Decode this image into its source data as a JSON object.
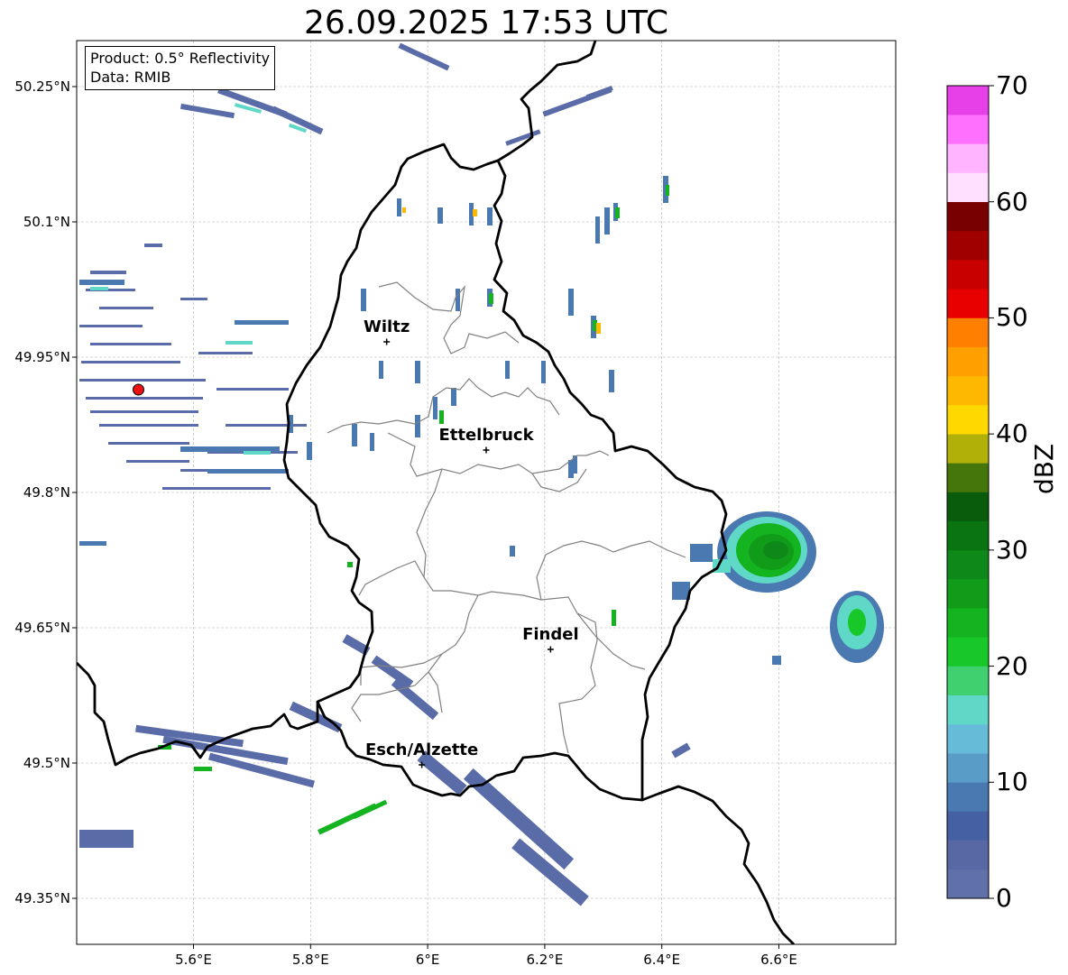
{
  "title": "26.09.2025 17:53 UTC",
  "info": {
    "product": "Product: 0.5° Reflectivity",
    "data": "Data: RMIB"
  },
  "map": {
    "lon_range": [
      5.4,
      6.8
    ],
    "lat_range": [
      49.3,
      50.3
    ],
    "lat_ticks": [
      {
        "value": 50.25,
        "label": "50.25°N"
      },
      {
        "value": 50.1,
        "label": "50.1°N"
      },
      {
        "value": 49.95,
        "label": "49.95°N"
      },
      {
        "value": 49.8,
        "label": "49.8°N"
      },
      {
        "value": 49.65,
        "label": "49.65°N"
      },
      {
        "value": 49.5,
        "label": "49.5°N"
      },
      {
        "value": 49.35,
        "label": "49.35°N"
      }
    ],
    "lon_ticks": [
      {
        "value": 5.6,
        "label": "5.6°E"
      },
      {
        "value": 5.8,
        "label": "5.8°E"
      },
      {
        "value": 6.0,
        "label": "6°E"
      },
      {
        "value": 6.2,
        "label": "6.2°E"
      },
      {
        "value": 6.4,
        "label": "6.4°E"
      },
      {
        "value": 6.6,
        "label": "6.6°E"
      }
    ],
    "cities": [
      {
        "name": "Wiltz",
        "lon": 5.93,
        "lat": 49.967
      },
      {
        "name": "Ettelbruck",
        "lon": 6.1,
        "lat": 49.847
      },
      {
        "name": "Findel",
        "lon": 6.21,
        "lat": 49.626
      },
      {
        "name": "Esch/Alzette",
        "lon": 5.99,
        "lat": 49.498
      }
    ],
    "radar_site": {
      "lon": 5.506,
      "lat": 49.914
    },
    "grid": true
  },
  "colorbar": {
    "label": "dBZ",
    "min": 0,
    "max": 70,
    "ticks": [
      {
        "value": 70,
        "label": "70"
      },
      {
        "value": 60,
        "label": "60"
      },
      {
        "value": 50,
        "label": "50"
      },
      {
        "value": 40,
        "label": "40"
      },
      {
        "value": 30,
        "label": "30"
      },
      {
        "value": 20,
        "label": "20"
      },
      {
        "value": 10,
        "label": "10"
      },
      {
        "value": 0,
        "label": "0"
      }
    ],
    "colors": [
      "#6070a8",
      "#5868a4",
      "#4660a4",
      "#4a78b0",
      "#5a9cc8",
      "#66bcd8",
      "#60d8c8",
      "#40d070",
      "#18c828",
      "#14b420",
      "#109c18",
      "#0e8818",
      "#0a7410",
      "#085c0c",
      "#44760c",
      "#b0b008",
      "#ffd800",
      "#ffb800",
      "#ffa000",
      "#ff8000",
      "#e80000",
      "#c80000",
      "#a00000",
      "#780000",
      "#ffe0ff",
      "#ffb4ff",
      "#ff70ff",
      "#e840e8"
    ]
  }
}
